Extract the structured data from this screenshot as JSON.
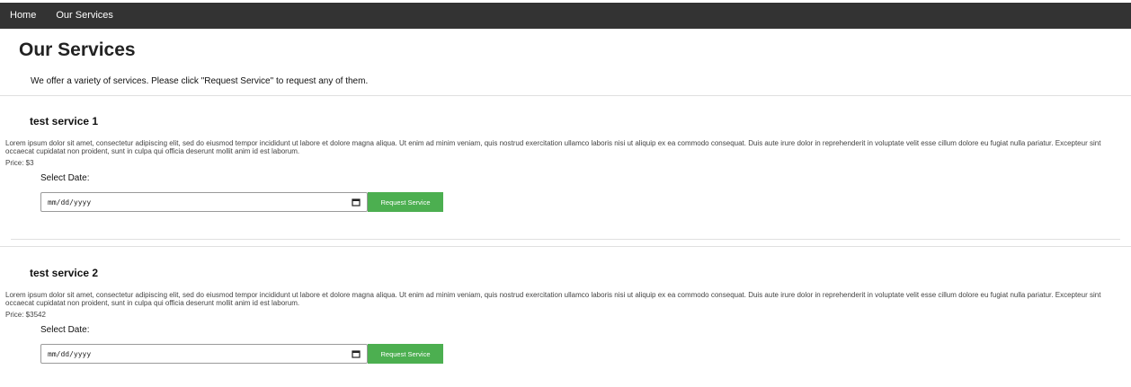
{
  "nav": {
    "items": [
      {
        "label": "Home"
      },
      {
        "label": "Our Services"
      }
    ]
  },
  "page": {
    "title": "Our Services",
    "intro": "We offer a variety of services. Please click \"Request Service\" to request any of them."
  },
  "services": [
    {
      "name": "test service 1",
      "description": "Lorem ipsum dolor sit amet, consectetur adipiscing elit, sed do eiusmod tempor incididunt ut labore et dolore magna aliqua. Ut enim ad minim veniam, quis nostrud exercitation ullamco laboris nisi ut aliquip ex ea commodo consequat. Duis aute irure dolor in reprehenderit in voluptate velit esse cillum dolore eu fugiat nulla pariatur. Excepteur sint occaecat cupidatat non proident, sunt in culpa qui officia deserunt mollit anim id est laborum.",
      "price": "Price: $3",
      "date_label": "Select Date:",
      "date_value": "mm/dd/yyyy",
      "button_label": "Request Service"
    },
    {
      "name": "test service 2",
      "description": "Lorem ipsum dolor sit amet, consectetur adipiscing elit, sed do eiusmod tempor incididunt ut labore et dolore magna aliqua. Ut enim ad minim veniam, quis nostrud exercitation ullamco laboris nisi ut aliquip ex ea commodo consequat. Duis aute irure dolor in reprehenderit in voluptate velit esse cillum dolore eu fugiat nulla pariatur. Excepteur sint occaecat cupidatat non proident, sunt in culpa qui officia deserunt mollit anim id est laborum.",
      "price": "Price: $3542",
      "date_label": "Select Date:",
      "date_value": "mm/dd/yyyy",
      "button_label": "Request Service"
    }
  ],
  "colors": {
    "navbar_bg": "#333333",
    "button_bg": "#4caf50"
  },
  "icons": {
    "date_picker": "calendar-icon"
  }
}
